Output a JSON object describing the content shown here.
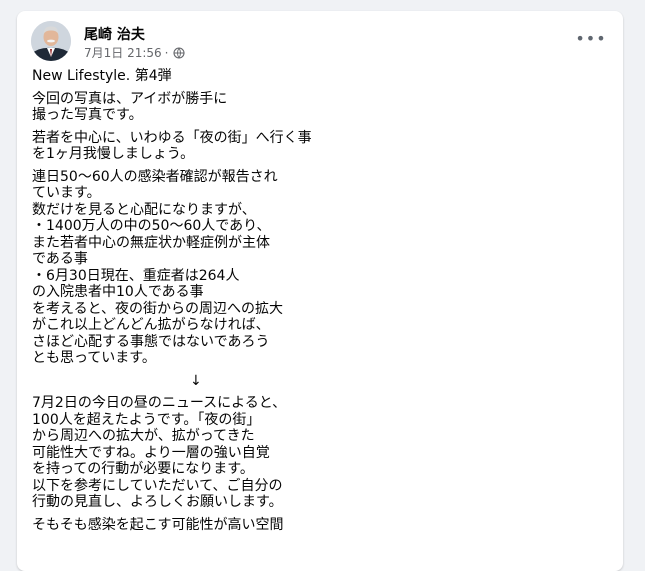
{
  "post": {
    "author": "尾崎 治夫",
    "date": "7月1日 21:56",
    "separator": "·",
    "more_label": "•••",
    "title": "New Lifestyle. 第4弾",
    "paragraphs": [
      [
        "今回の写真は、アイボが勝手に",
        "撮った写真です。"
      ],
      [
        "若者を中心に、いわゆる「夜の街」へ行く事",
        "を1ヶ月我慢しましょう。"
      ],
      [
        "連日50～60人の感染者確認が報告され",
        "ています。",
        "数だけを見ると心配になりますが、",
        "・1400万人の中の50～60人であり、",
        "また若者中心の無症状か軽症例が主体",
        "である事",
        "・6月30日現在、重症者は264人",
        "の入院患者中10人である事",
        "を考えると、夜の街からの周辺への拡大",
        "がこれ以上どんどん拡がらなければ、",
        "さほど心配する事態ではないであろう",
        "とも思っています。"
      ],
      [
        "7月2日の今日の昼のニュースによると、",
        "100人を超えたようです。「夜の街」",
        "から周辺への拡大が、拡がってきた",
        "可能性大ですね。より一層の強い自覚",
        "を持っての行動が必要になります。",
        "以下を参考にしていただいて、ご自分の",
        "行動の見直し、よろしくお願いします。"
      ],
      [
        "そもそも感染を起こす可能性が高い空間"
      ]
    ],
    "arrow": "↓"
  }
}
